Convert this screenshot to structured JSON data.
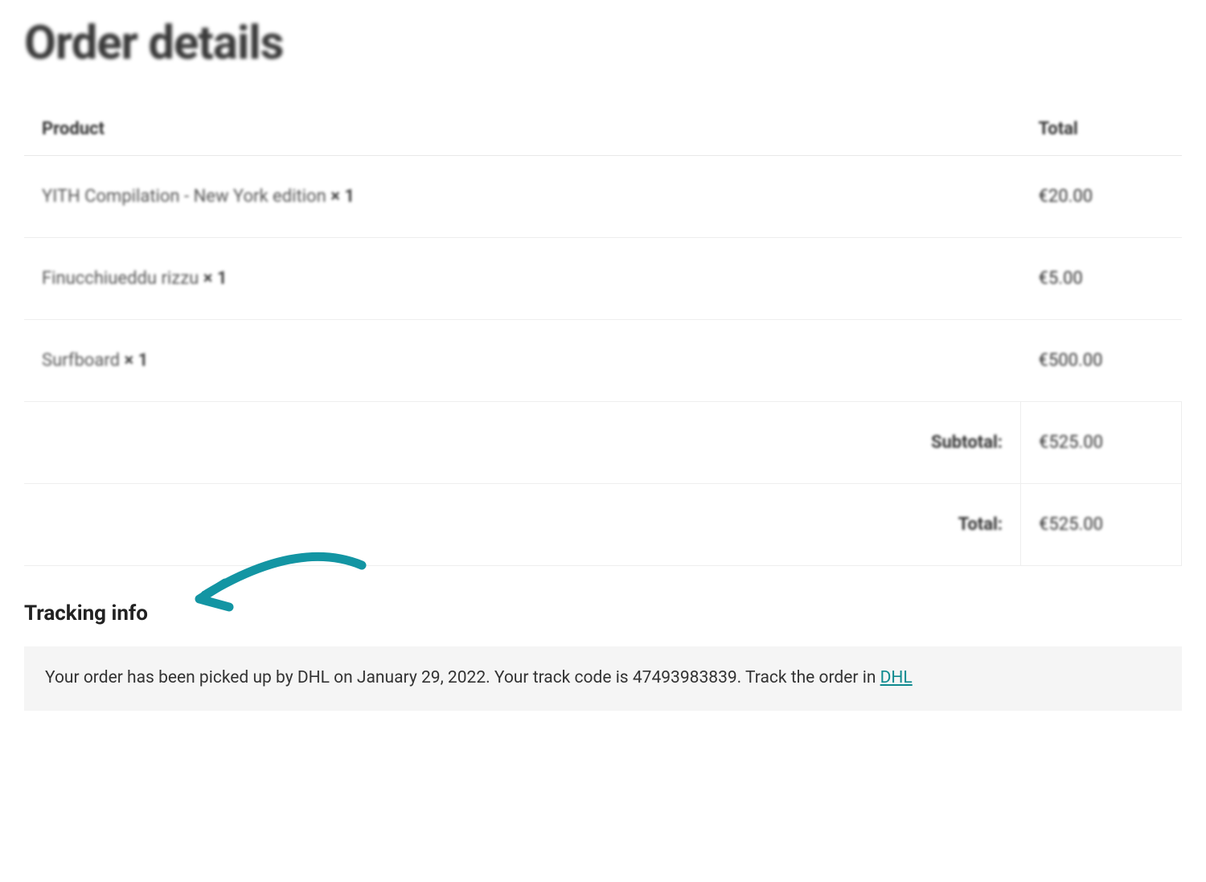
{
  "page": {
    "title": "Order details"
  },
  "table": {
    "headers": {
      "product": "Product",
      "total": "Total"
    },
    "rows": [
      {
        "product": "YITH Compilation - New York edition",
        "qty": "× 1",
        "price": "€20.00"
      },
      {
        "product": "Finucchiueddu rizzu",
        "qty": "× 1",
        "price": "€5.00"
      },
      {
        "product": "Surfboard",
        "qty": "× 1",
        "price": "€500.00"
      }
    ],
    "footer": {
      "subtotal_label": "Subtotal:",
      "subtotal_value": "€525.00",
      "total_label": "Total:",
      "total_value": "€525.00"
    }
  },
  "tracking": {
    "heading": "Tracking info",
    "message_prefix": "Your order has been picked up by DHL on January 29, 2022. Your track code is 47493983839. Track the order in ",
    "link_text": "DHL"
  }
}
